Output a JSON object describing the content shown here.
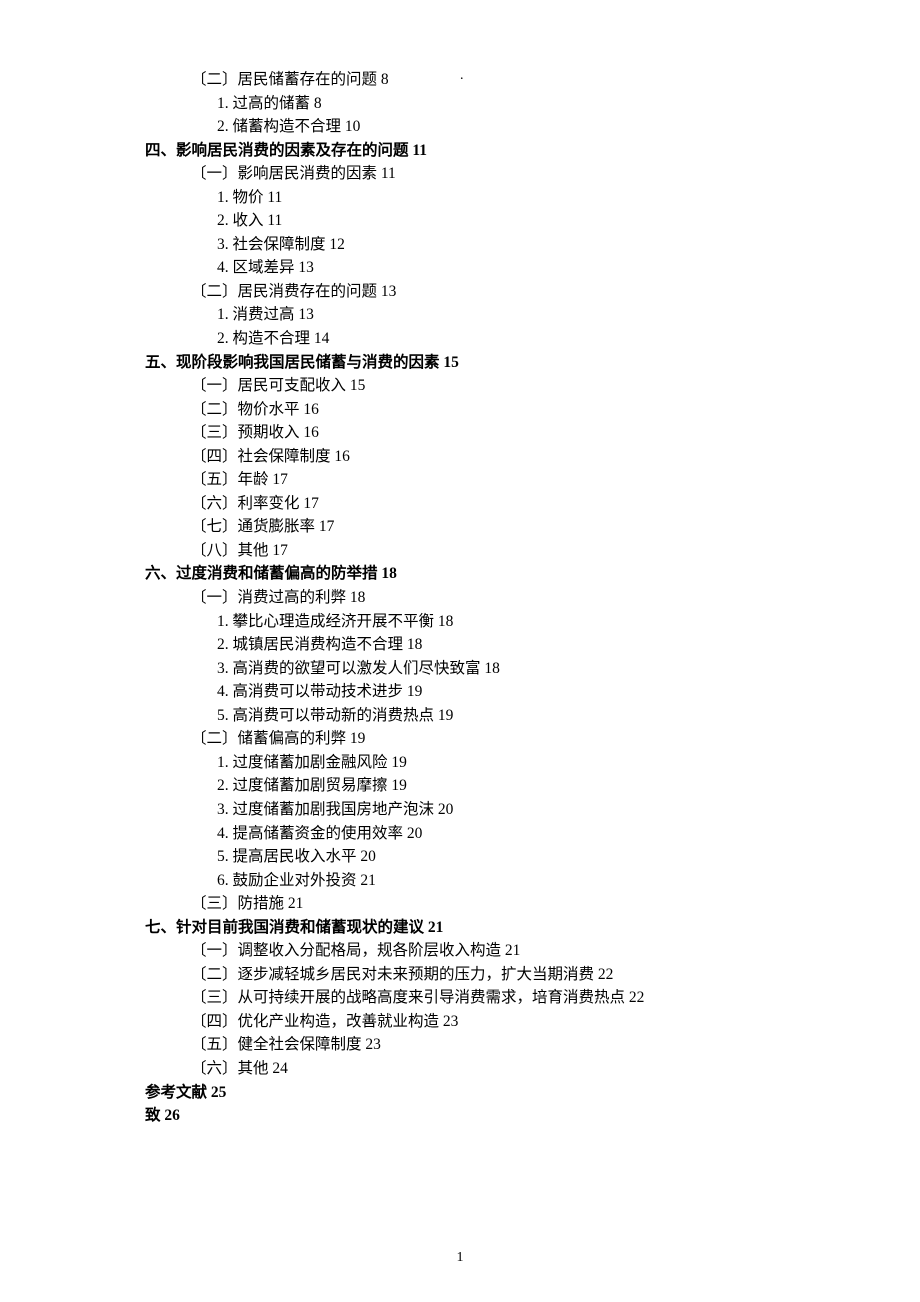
{
  "top_dot": ".",
  "toc": [
    {
      "level": 2,
      "text": "〔二〕居民储蓄存在的问题 8"
    },
    {
      "level": 3,
      "text": "1. 过高的储蓄 8"
    },
    {
      "level": 3,
      "text": "2. 储蓄构造不合理 10"
    },
    {
      "level": 1,
      "text": "四、影响居民消费的因素及存在的问题 11"
    },
    {
      "level": 2,
      "text": "〔一〕影响居民消费的因素 11"
    },
    {
      "level": 3,
      "text": "1. 物价 11"
    },
    {
      "level": 3,
      "text": "2. 收入 11"
    },
    {
      "level": 3,
      "text": "3. 社会保障制度 12"
    },
    {
      "level": 3,
      "text": "4. 区域差异 13"
    },
    {
      "level": 2,
      "text": "〔二〕居民消费存在的问题 13"
    },
    {
      "level": 3,
      "text": "1. 消费过高 13"
    },
    {
      "level": 3,
      "text": "2. 构造不合理 14"
    },
    {
      "level": 1,
      "text": "五、现阶段影响我国居民储蓄与消费的因素 15"
    },
    {
      "level": 2,
      "text": "〔一〕居民可支配收入 15"
    },
    {
      "level": 2,
      "text": "〔二〕物价水平 16"
    },
    {
      "level": 2,
      "text": "〔三〕预期收入 16"
    },
    {
      "level": 2,
      "text": "〔四〕社会保障制度 16"
    },
    {
      "level": 2,
      "text": "〔五〕年龄 17"
    },
    {
      "level": 2,
      "text": "〔六〕利率变化 17"
    },
    {
      "level": 2,
      "text": "〔七〕通货膨胀率 17"
    },
    {
      "level": 2,
      "text": "〔八〕其他 17"
    },
    {
      "level": 1,
      "text": "六、过度消费和储蓄偏高的防举措 18"
    },
    {
      "level": 2,
      "text": "〔一〕消费过高的利弊 18"
    },
    {
      "level": 3,
      "text": "1. 攀比心理造成经济开展不平衡 18"
    },
    {
      "level": 3,
      "text": "2. 城镇居民消费构造不合理 18"
    },
    {
      "level": 3,
      "text": "3. 高消费的欲望可以激发人们尽快致富 18"
    },
    {
      "level": 3,
      "text": "4. 高消费可以带动技术进步 19"
    },
    {
      "level": 3,
      "text": "5. 高消费可以带动新的消费热点 19"
    },
    {
      "level": 2,
      "text": "〔二〕储蓄偏高的利弊 19"
    },
    {
      "level": 3,
      "text": "1. 过度储蓄加剧金融风险 19"
    },
    {
      "level": 3,
      "text": "2. 过度储蓄加剧贸易摩擦 19"
    },
    {
      "level": 3,
      "text": "3. 过度储蓄加剧我国房地产泡沫 20"
    },
    {
      "level": 3,
      "text": "4. 提高储蓄资金的使用效率 20"
    },
    {
      "level": 3,
      "text": "5. 提高居民收入水平 20"
    },
    {
      "level": 3,
      "text": "6. 鼓励企业对外投资 21"
    },
    {
      "level": 2,
      "text": "〔三〕防措施 21"
    },
    {
      "level": 1,
      "text": "七、针对目前我国消费和储蓄现状的建议 21"
    },
    {
      "level": 2,
      "text": "〔一〕调整收入分配格局，规各阶层收入构造 21"
    },
    {
      "level": 2,
      "text": "〔二〕逐步减轻城乡居民对未来预期的压力，扩大当期消费 22"
    },
    {
      "level": 2,
      "text": "〔三〕从可持续开展的战略高度来引导消费需求，培育消费热点 22"
    },
    {
      "level": 2,
      "text": "〔四〕优化产业构造，改善就业构造 23"
    },
    {
      "level": 2,
      "text": "〔五〕健全社会保障制度 23"
    },
    {
      "level": 2,
      "text": "〔六〕其他 24"
    },
    {
      "level": 0,
      "text": "参考文献 25"
    },
    {
      "level": 0,
      "text": "致 26"
    }
  ],
  "page_number": "1"
}
